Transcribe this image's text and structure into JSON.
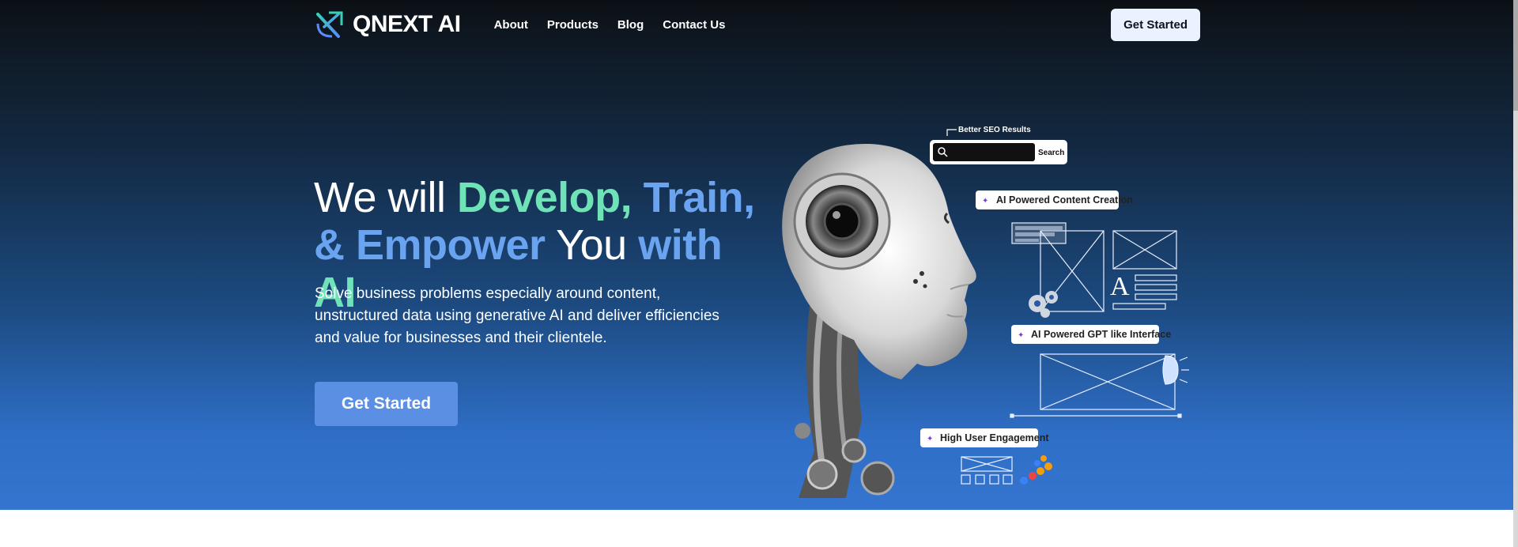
{
  "brand": {
    "name_q": "Q",
    "name_rest": "NEXT AI"
  },
  "nav": {
    "links": [
      {
        "label": "About"
      },
      {
        "label": "Products"
      },
      {
        "label": "Blog"
      },
      {
        "label": "Contact Us"
      }
    ],
    "cta_label": "Get Started"
  },
  "hero": {
    "headline": {
      "part1": "We will ",
      "part2": "Develop,",
      "part3": " Train,",
      "part4": "& Empower",
      "part5": " You ",
      "part6": "with",
      "part7": " AI"
    },
    "subtext": "Solve business problems especially around content, unstructured data using generative AI and deliver efficiencies and value for businesses and their clientele.",
    "cta_label": "Get Started"
  },
  "illustration": {
    "seo_label": "Better SEO Results",
    "search_button": "Search",
    "tag1": "AI Powered Content Creation",
    "tag2": "AI Powered GPT like Interface",
    "tag3": "High User Engagement",
    "glyph_a": "A"
  },
  "colors": {
    "accent_green": "#6fe3b7",
    "accent_blue": "#6aa3ef",
    "button_blue": "#5b8fe3"
  }
}
